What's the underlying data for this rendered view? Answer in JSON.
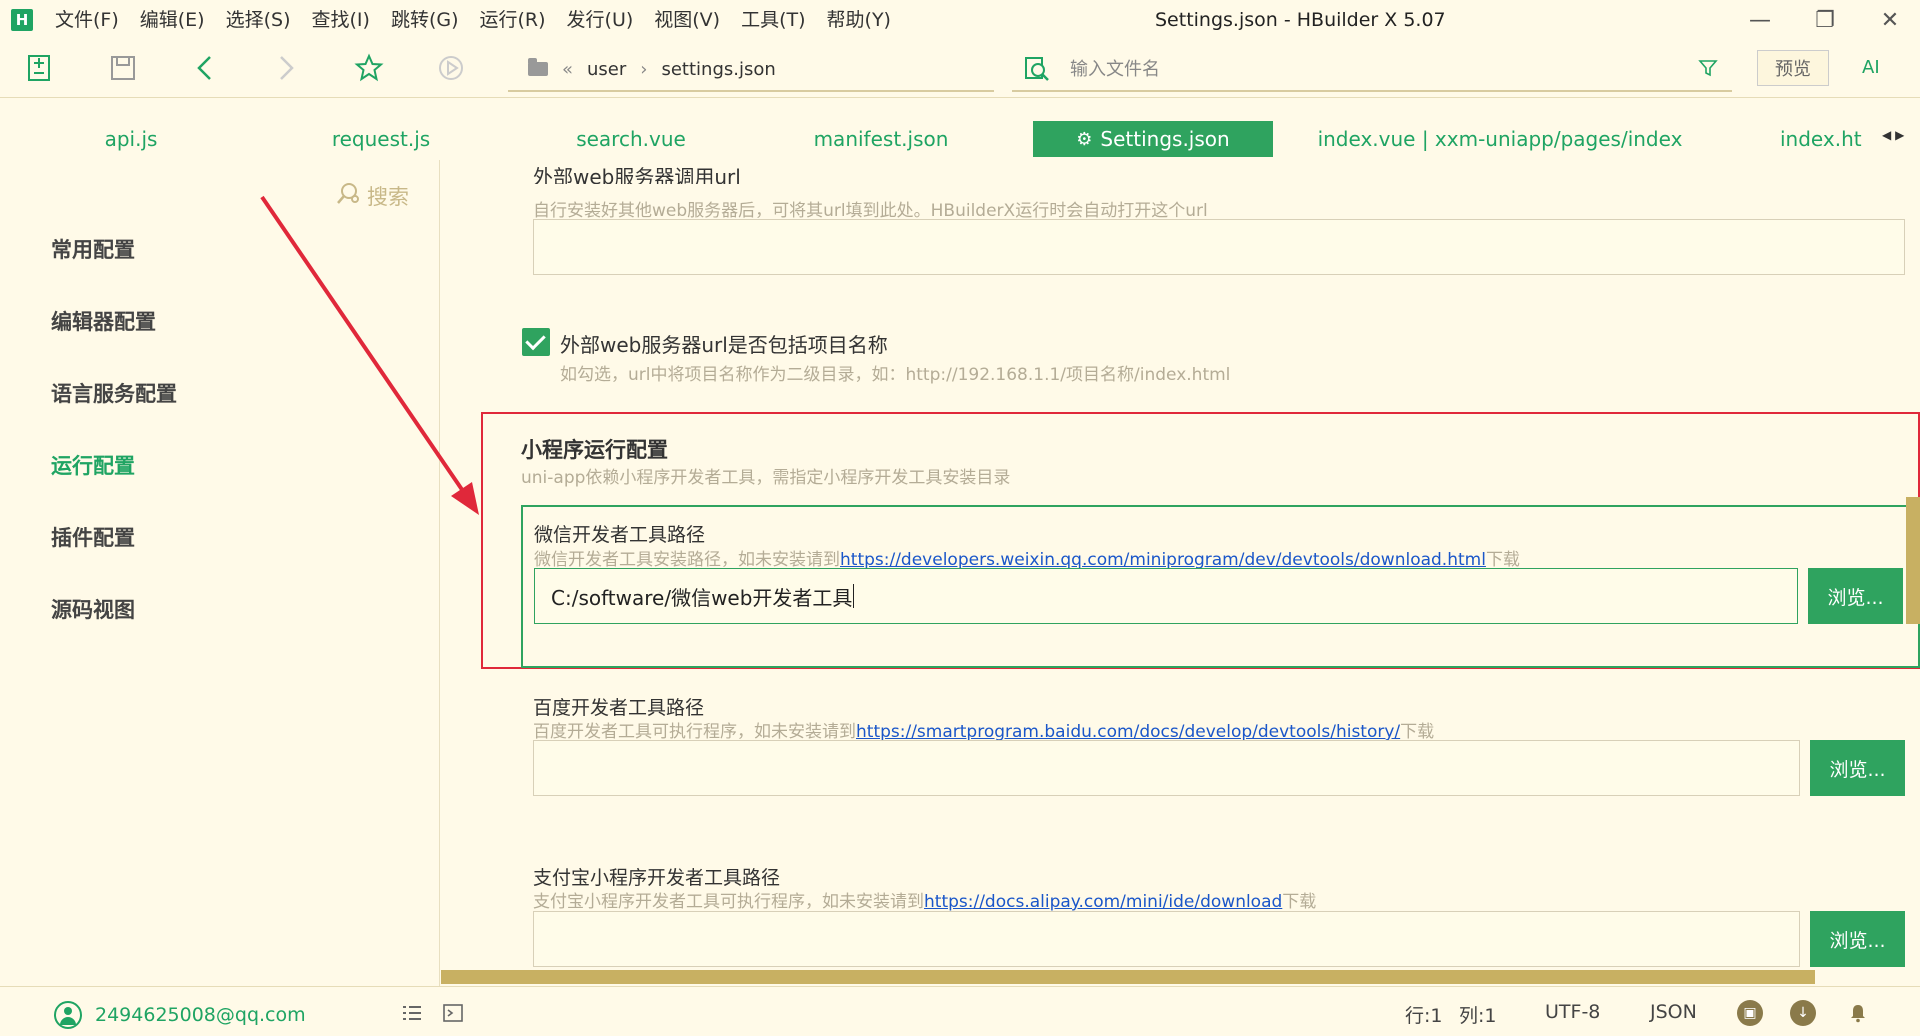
{
  "app": {
    "logo_text": "H",
    "window_title": "Settings.json - HBuilder X 5.07",
    "menu": [
      "文件(F)",
      "编辑(E)",
      "选择(S)",
      "查找(I)",
      "跳转(G)",
      "运行(R)",
      "发行(U)",
      "视图(V)",
      "工具(T)",
      "帮助(Y)"
    ]
  },
  "toolbar": {
    "path": [
      "user",
      "settings.json"
    ],
    "file_search_placeholder": "输入文件名",
    "preview_label": "预览",
    "ai_label": "AI"
  },
  "tabs": [
    {
      "label": "api.js",
      "active": false
    },
    {
      "label": "request.js",
      "active": false
    },
    {
      "label": "search.vue",
      "active": false
    },
    {
      "label": "manifest.json",
      "active": false
    },
    {
      "label": "Settings.json",
      "active": true
    },
    {
      "label": "index.vue | xxm-uniapp/pages/index",
      "active": false
    },
    {
      "label": "index.ht",
      "active": false
    }
  ],
  "sidebar": {
    "search_label": "搜索",
    "items": [
      {
        "label": "常用配置",
        "active": false
      },
      {
        "label": "编辑器配置",
        "active": false
      },
      {
        "label": "语言服务配置",
        "active": false
      },
      {
        "label": "运行配置",
        "active": true
      },
      {
        "label": "插件配置",
        "active": false
      },
      {
        "label": "源码视图",
        "active": false
      }
    ]
  },
  "settings": {
    "external_url": {
      "title": "外部web服务器调用url",
      "desc": "自行安装好其他web服务器后，可将其url填到此处。HBuilderX运行时会自动打开这个url",
      "value": ""
    },
    "include_project": {
      "label": "外部web服务器url是否包括项目名称",
      "desc": "如勾选，url中将项目名称作为二级目录，如：http://192.168.1.1/项目名称/index.html",
      "checked": true
    },
    "miniprogram": {
      "title": "小程序运行配置",
      "desc": "uni-app依赖小程序开发者工具，需指定小程序开发工具安装目录"
    },
    "wechat": {
      "title": "微信开发者工具路径",
      "desc_prefix": "微信开发者工具安装路径，如未安装请到",
      "link": "https://developers.weixin.qq.com/miniprogram/dev/devtools/download.html",
      "desc_suffix": "下载",
      "value": "C:/software/微信web开发者工具",
      "browse": "浏览..."
    },
    "baidu": {
      "title": "百度开发者工具路径",
      "desc_prefix": "百度开发者工具可执行程序，如未安装请到",
      "link": "https://smartprogram.baidu.com/docs/develop/devtools/history/",
      "desc_suffix": "下载",
      "value": "",
      "browse": "浏览..."
    },
    "alipay": {
      "title": "支付宝小程序开发者工具路径",
      "desc_prefix": "支付宝小程序开发者工具可执行程序，如未安装请到",
      "link": "https://docs.alipay.com/mini/ide/download",
      "desc_suffix": "下载",
      "value": "",
      "browse": "浏览..."
    }
  },
  "status": {
    "user": "2494625008@qq.com",
    "line": "行:1",
    "col": "列:1",
    "encoding": "UTF-8",
    "language": "JSON"
  },
  "colors": {
    "accent": "#2fa35f",
    "highlight_border": "#e0283a",
    "background": "#fffae8",
    "link": "#1a56c9"
  }
}
